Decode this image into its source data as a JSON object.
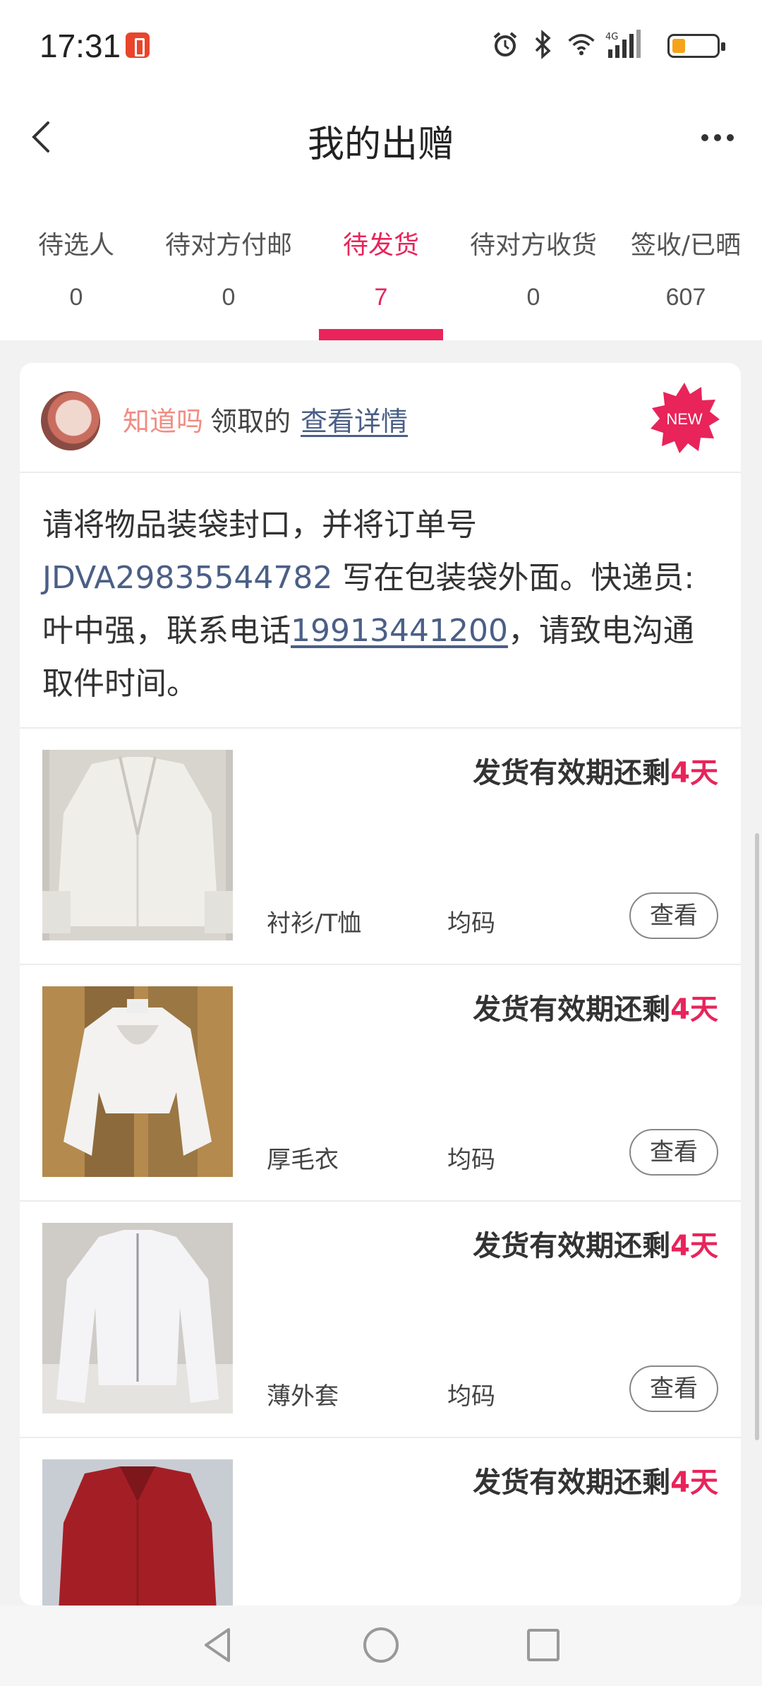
{
  "status": {
    "time": "17:31",
    "network": "4G"
  },
  "header": {
    "title": "我的出赠"
  },
  "tabs": [
    {
      "label": "待选人",
      "count": "0"
    },
    {
      "label": "待对方付邮",
      "count": "0"
    },
    {
      "label": "待发货",
      "count": "7"
    },
    {
      "label": "待对方收货",
      "count": "0"
    },
    {
      "label": "签收/已晒",
      "count": "607"
    }
  ],
  "active_tab": 2,
  "card": {
    "giver_name": "知道吗",
    "giver_action": "领取的",
    "detail_link": "查看详情",
    "badge": "NEW",
    "instructions": {
      "part1": "请将物品装袋封口，并将订单号 ",
      "order_no": "JDVA29835544782",
      "part2": " 写在包装袋外面。快递员:叶中强，联系电话",
      "phone": "19913441200",
      "part3": "，请致电沟通取件时间。"
    },
    "items": [
      {
        "deadline_prefix": "发货有效期还剩",
        "deadline_days": "4天",
        "category": "衬衫/T恤",
        "size": "均码",
        "button": "查看"
      },
      {
        "deadline_prefix": "发货有效期还剩",
        "deadline_days": "4天",
        "category": "厚毛衣",
        "size": "均码",
        "button": "查看"
      },
      {
        "deadline_prefix": "发货有效期还剩",
        "deadline_days": "4天",
        "category": "薄外套",
        "size": "均码",
        "button": "查看"
      },
      {
        "deadline_prefix": "发货有效期还剩",
        "deadline_days": "4天",
        "category": "",
        "size": "",
        "button": ""
      }
    ]
  },
  "colors": {
    "accent": "#e8245a",
    "link": "#4b5f86",
    "giver": "#f08d84"
  }
}
